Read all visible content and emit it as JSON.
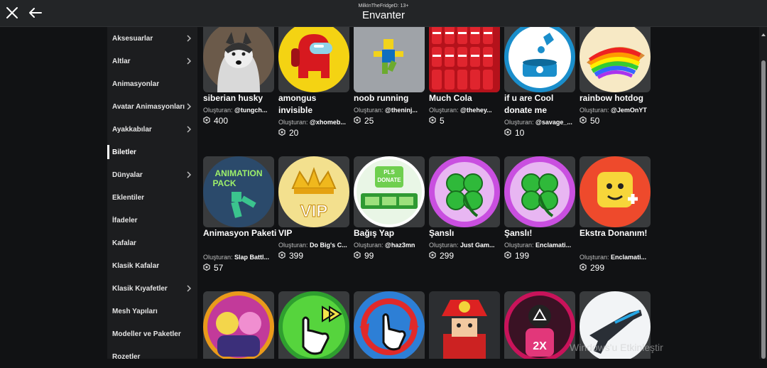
{
  "header": {
    "user_line": "MilkInTheFridgeD: 13+",
    "title": "Envanter",
    "close_label": "close",
    "back_label": "back"
  },
  "sidebar": {
    "items": [
      {
        "label": "Aksesuarlar",
        "chevron": true,
        "active": false
      },
      {
        "label": "Altlar",
        "chevron": true,
        "active": false
      },
      {
        "label": "Animasyonlar",
        "chevron": false,
        "active": false
      },
      {
        "label": "Avatar Animasyonları",
        "chevron": true,
        "active": false
      },
      {
        "label": "Ayakkabılar",
        "chevron": true,
        "active": false
      },
      {
        "label": "Biletler",
        "chevron": false,
        "active": true
      },
      {
        "label": "Dünyalar",
        "chevron": true,
        "active": false
      },
      {
        "label": "Eklentiler",
        "chevron": false,
        "active": false
      },
      {
        "label": "İfadeler",
        "chevron": false,
        "active": false
      },
      {
        "label": "Kafalar",
        "chevron": false,
        "active": false
      },
      {
        "label": "Klasik Kafalar",
        "chevron": false,
        "active": false
      },
      {
        "label": "Klasik Kıyafetler",
        "chevron": true,
        "active": false
      },
      {
        "label": "Mesh Yapıları",
        "chevron": false,
        "active": false
      },
      {
        "label": "Modeller ve Paketler",
        "chevron": false,
        "active": false
      },
      {
        "label": "Rozetler",
        "chevron": false,
        "active": false
      }
    ]
  },
  "grid": {
    "creator_prefix": "Oluşturan:",
    "rows": [
      [
        {
          "name": "siberian husky",
          "creator": "@tungch...",
          "price": "400",
          "icon": "husky-icon"
        },
        {
          "name": "amongus invisible",
          "creator": "@xhomeb...",
          "price": "20",
          "icon": "amongus-icon"
        },
        {
          "name": "noob running",
          "creator": "@theninj...",
          "price": "25",
          "icon": "noob-icon"
        },
        {
          "name": "Much Cola",
          "creator": "@thehey...",
          "price": "5",
          "icon": "cola-icon"
        },
        {
          "name": "if u are Cool donate me",
          "creator": "@savage_...",
          "price": "10",
          "icon": "donate-jar-icon"
        },
        {
          "name": "rainbow hotdog",
          "creator": "@JemOnYT",
          "price": "50",
          "icon": "hotdog-icon"
        }
      ],
      [
        {
          "name": "Animasyon Paketi",
          "creator": "Slap Battl...",
          "price": "57",
          "icon": "animation-pack-icon"
        },
        {
          "name": "VIP",
          "creator": "Do Big's C...",
          "price": "399",
          "icon": "vip-crown-icon"
        },
        {
          "name": "Bağış Yap",
          "creator": "@haz3mn",
          "price": "99",
          "icon": "pls-donate-icon"
        },
        {
          "name": "Şanslı",
          "creator": "Just Gam...",
          "price": "299",
          "icon": "clover-icon"
        },
        {
          "name": "Şanslı!",
          "creator": "Enclamati...",
          "price": "199",
          "icon": "clover-icon"
        },
        {
          "name": "Ekstra Donanım!",
          "creator": "Enclamati...",
          "price": "299",
          "icon": "extra-gear-icon"
        }
      ],
      [
        {
          "name": "",
          "creator": "",
          "price": "",
          "icon": "cartoon-duo-icon"
        },
        {
          "name": "",
          "creator": "",
          "price": "",
          "icon": "auto-click-icon"
        },
        {
          "name": "",
          "creator": "",
          "price": "",
          "icon": "rebirth-click-icon"
        },
        {
          "name": "",
          "creator": "",
          "price": "",
          "icon": "flower-hat-icon"
        },
        {
          "name": "",
          "creator": "",
          "price": "",
          "icon": "2x-squid-icon"
        },
        {
          "name": "",
          "creator": "",
          "price": "",
          "icon": "blaster-icon"
        }
      ]
    ]
  },
  "watermark": "Windows'u Etkinleştir"
}
